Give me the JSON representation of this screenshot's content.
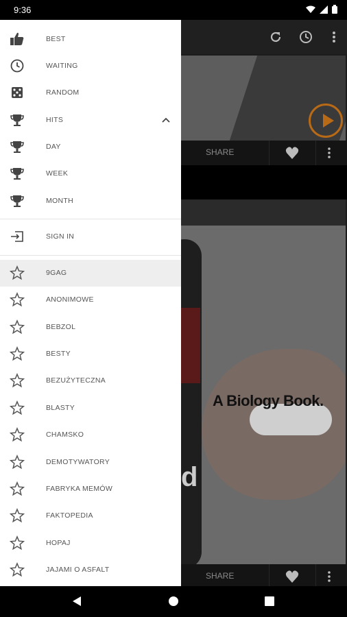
{
  "status": {
    "time": "9:36"
  },
  "drawer": {
    "primary": [
      {
        "label": "BEST",
        "icon": "thumbs-up-icon"
      },
      {
        "label": "WAITING",
        "icon": "clock-icon"
      },
      {
        "label": "RANDOM",
        "icon": "dice-icon"
      },
      {
        "label": "HITS",
        "icon": "trophy-icon"
      },
      {
        "label": "DAY",
        "icon": "trophy-icon"
      },
      {
        "label": "WEEK",
        "icon": "trophy-icon"
      },
      {
        "label": "MONTH",
        "icon": "trophy-icon"
      }
    ],
    "sign_in": {
      "label": "SIGN IN",
      "icon": "login-icon"
    },
    "sources": [
      {
        "label": "9GAG"
      },
      {
        "label": "ANONIMOWE"
      },
      {
        "label": "BEBZOL"
      },
      {
        "label": "BESTY"
      },
      {
        "label": "BEZUŻYTECZNA"
      },
      {
        "label": "BLASTY"
      },
      {
        "label": "CHAMSKO"
      },
      {
        "label": "DEMOTYWATORY"
      },
      {
        "label": "FABRYKA MEMÓW"
      },
      {
        "label": "FAKTOPEDIA"
      },
      {
        "label": "HOPAJ"
      },
      {
        "label": "JAJAMI O ASFALT"
      }
    ]
  },
  "feed": {
    "share_label": "SHARE",
    "card2_caption": "A Biology Book.",
    "card2_fragment": "d"
  },
  "colors": {
    "accent": "#b86a16",
    "drawer_bg": "#ffffff",
    "active_item": "#eeeeee"
  }
}
